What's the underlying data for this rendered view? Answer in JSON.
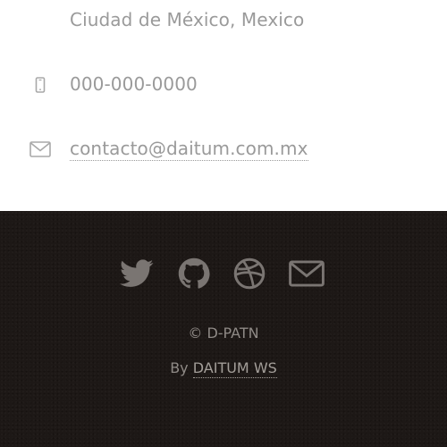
{
  "contact": {
    "city": "Ciudad de México, Mexico",
    "phone": "000-000-0000",
    "email": "contacto@daitum.com.mx",
    "icon_phone": "mobile-phone-icon",
    "icon_email": "envelope-icon"
  },
  "footer": {
    "social": [
      {
        "name": "twitter-icon"
      },
      {
        "name": "github-icon"
      },
      {
        "name": "dribbble-icon"
      },
      {
        "name": "mail-icon"
      }
    ],
    "copyright": "© D-PATN",
    "by_prefix": "By",
    "by_link": "DAITUM WS"
  },
  "colors": {
    "contact_text": "#9a9a9a",
    "icon_light": "#a8a8a8",
    "footer_bg": "#1d1816",
    "footer_text": "#8f8a86",
    "social_icon": "#7a7572"
  }
}
